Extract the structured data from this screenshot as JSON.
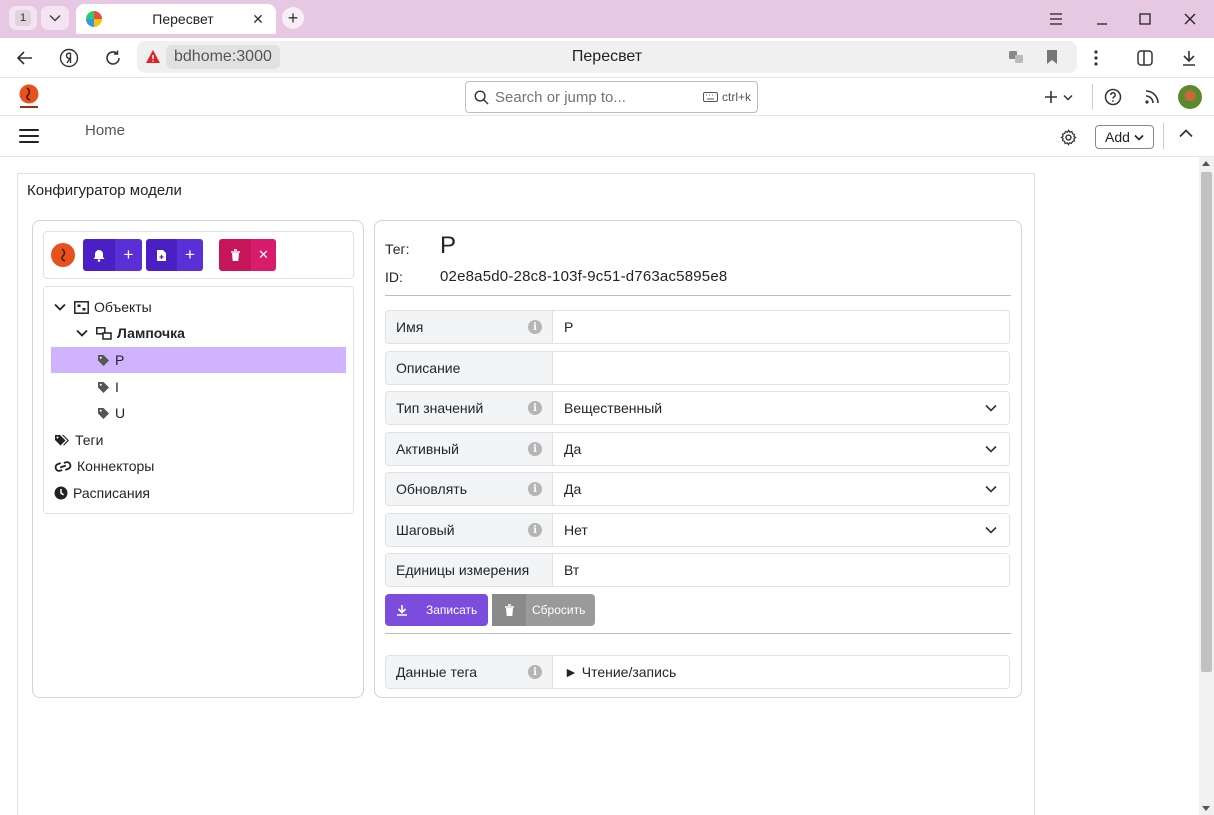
{
  "browser": {
    "tab_count": "1",
    "tab_title": "Пересвет",
    "url_host": "bdhome:3000",
    "page_title": "Пересвет"
  },
  "app": {
    "search_placeholder": "Search or jump to...",
    "search_shortcut": "ctrl+k",
    "breadcrumb": "Home",
    "add_label": "Add"
  },
  "card": {
    "title": "Конфигуратор модели"
  },
  "tree": {
    "objects": "Объекты",
    "lamp": "Лампочка",
    "tags_children": [
      "P",
      "I",
      "U"
    ],
    "tags": "Теги",
    "connectors": "Коннекторы",
    "schedules": "Расписания"
  },
  "detail": {
    "tag_label": "Тег:",
    "tag_value": "P",
    "id_label": "ID:",
    "id_value": "02e8a5d0-28c8-103f-9c51-d763ac5895e8",
    "fields": [
      {
        "label": "Имя",
        "value": "P"
      },
      {
        "label": "Описание",
        "value": ""
      },
      {
        "label": "Тип значений",
        "value": "Вещественный"
      },
      {
        "label": "Активный",
        "value": "Да"
      },
      {
        "label": "Обновлять",
        "value": "Да"
      },
      {
        "label": "Шаговый",
        "value": "Нет"
      },
      {
        "label": "Единицы измерения",
        "value": "Вт"
      }
    ],
    "save_label": "Записать",
    "reset_label": "Сбросить",
    "data_label": "Данные тега",
    "data_value": "► Чтение/запись"
  },
  "colors": {
    "tab_bg": "#e6c8e2",
    "purple_dark": "#4a1fc4",
    "purple_btn": "#7c4ddc",
    "magenta": "#c7155c",
    "selected": "#cfb3ff",
    "gray_btn": "#9a9a9a"
  }
}
